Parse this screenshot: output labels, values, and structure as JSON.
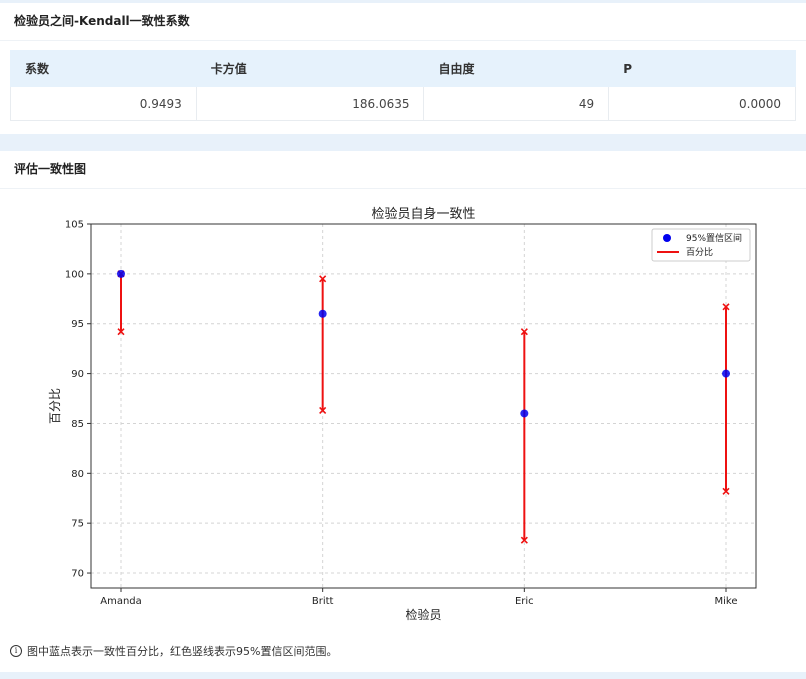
{
  "kendall": {
    "title": "检验员之间-Kendall一致性系数",
    "headers": [
      "系数",
      "卡方值",
      "自由度",
      "P"
    ],
    "row": [
      "0.9493",
      "186.0635",
      "49",
      "0.0000"
    ]
  },
  "assessment": {
    "title": "评估一致性图",
    "note": "图中蓝点表示一致性百分比，红色竖线表示95%置信区间范围。",
    "info_icon": "info-icon"
  },
  "chart_data": {
    "type": "scatter",
    "title": "检验员自身一致性",
    "xlabel": "检验员",
    "ylabel": "百分比",
    "categories": [
      "Amanda",
      "Britt",
      "Eric",
      "Mike"
    ],
    "percent": [
      100,
      96,
      86,
      90
    ],
    "ci_lower": [
      94.2,
      86.3,
      73.3,
      78.2
    ],
    "ci_upper": [
      100,
      99.5,
      94.2,
      96.7
    ],
    "ylim": [
      68.5,
      105
    ],
    "yticks": [
      70,
      75,
      80,
      85,
      90,
      95,
      100,
      105
    ],
    "grid": true,
    "legend_position": "top-right",
    "legend": [
      "95%置信区间",
      "百分比"
    ],
    "colors": {
      "point": "#0000ee",
      "interval": "#ee1111"
    }
  }
}
